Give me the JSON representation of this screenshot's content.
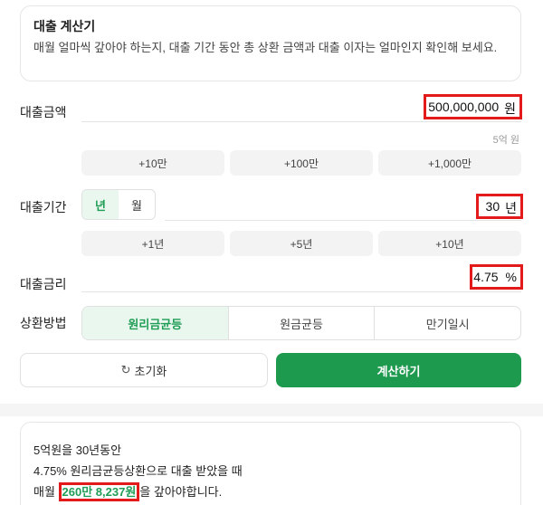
{
  "info": {
    "title": "대출 계산기",
    "description": "매월 얼마씩 갚아야 하는지, 대출 기간 동안 총 상환 금액과 대출 이자는 얼마인지 확인해 보세요."
  },
  "amount": {
    "label": "대출금액",
    "value": "500,000,000",
    "unit": "원",
    "hint": "5억 원",
    "chips": [
      "+10만",
      "+100만",
      "+1,000만"
    ]
  },
  "period": {
    "label": "대출기간",
    "units": [
      "년",
      "월"
    ],
    "selected_unit": "년",
    "value": "30",
    "unit": "년",
    "chips": [
      "+1년",
      "+5년",
      "+10년"
    ]
  },
  "rate": {
    "label": "대출금리",
    "value": "4.75",
    "unit": "%"
  },
  "method": {
    "label": "상환방법",
    "options": [
      "원리금균등",
      "원금균등",
      "만기일시"
    ],
    "selected": "원리금균등"
  },
  "actions": {
    "reset_icon": "refresh-icon",
    "reset_label": "초기화",
    "calc_label": "계산하기"
  },
  "colors": {
    "accent": "#1e9a4e",
    "highlight_border": "#e21a1a"
  },
  "result": {
    "line1": "5억원을 30년동안",
    "line2": "4.75% 원리금균등상환으로 대출 받았을 때",
    "line3_prefix": "매월 ",
    "monthly_amount": "260만 8,237원",
    "line3_suffix": "을 갚아야합니다."
  }
}
